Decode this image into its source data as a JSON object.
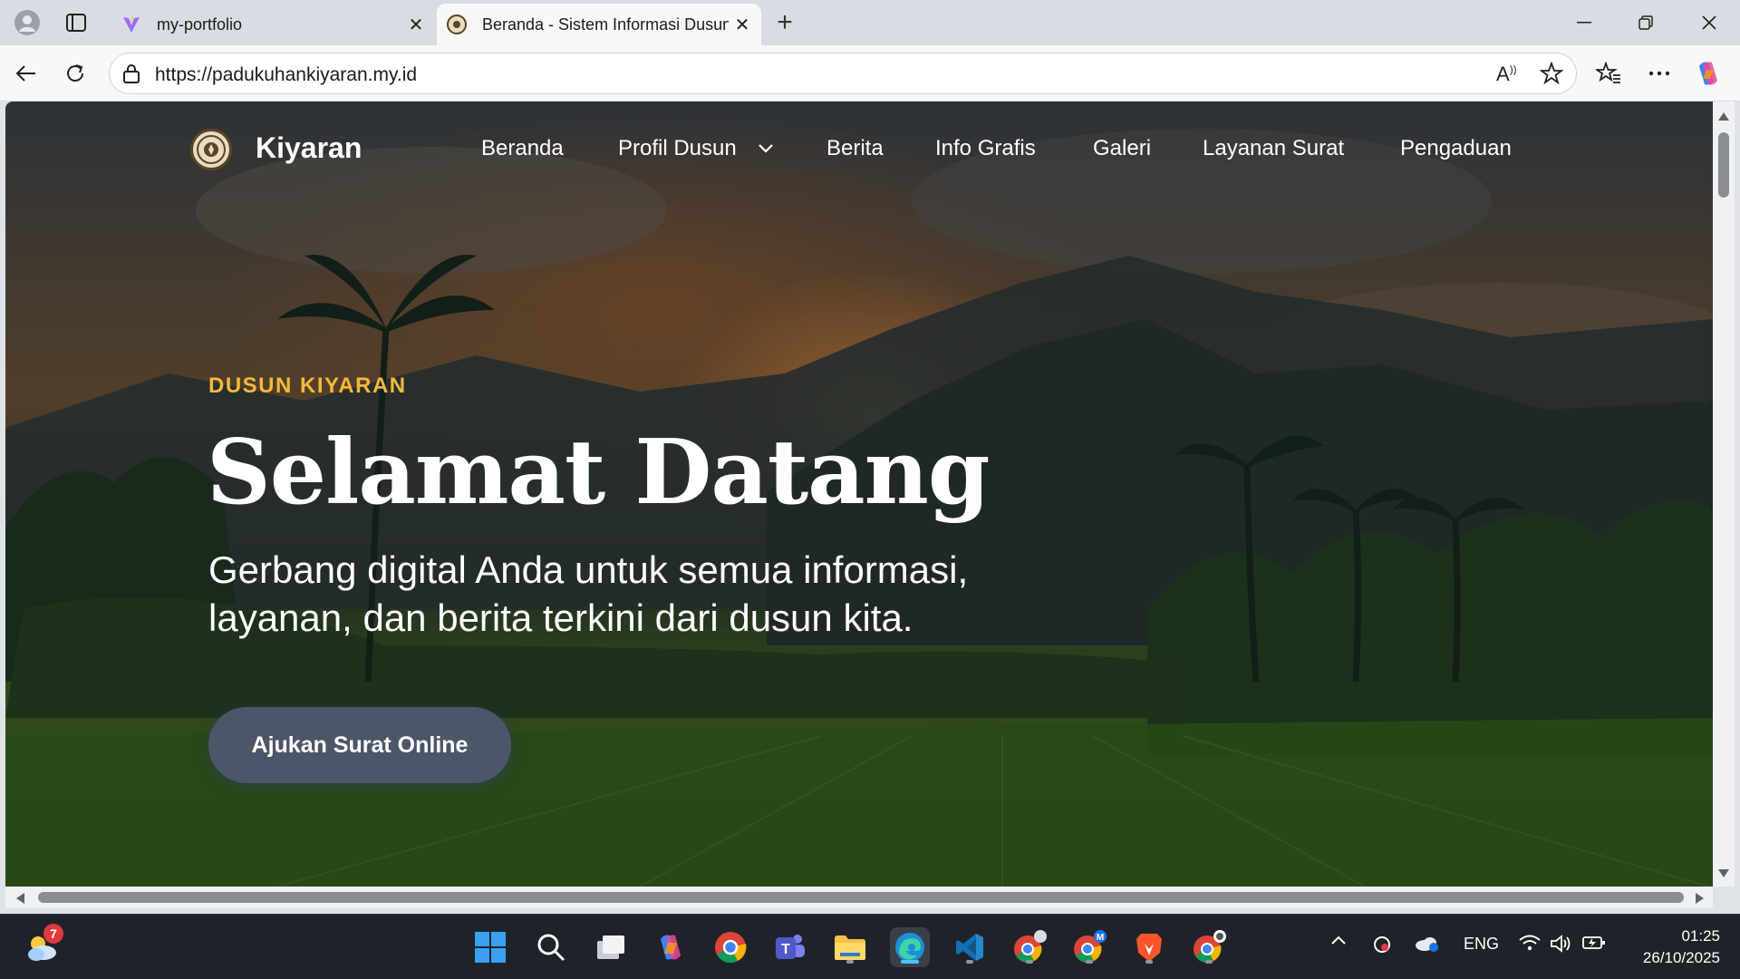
{
  "browser": {
    "tabs": [
      {
        "title": "my-portfolio",
        "favicon": "vite-icon",
        "active": false
      },
      {
        "title": "Beranda - Sistem Informasi Dusun",
        "favicon": "village-seal-icon",
        "active": true
      }
    ],
    "address_url": "https://padukuhankiyaran.my.id"
  },
  "site": {
    "brand": "Kiyaran",
    "nav": [
      "Beranda",
      "Profil Dusun",
      "Berita",
      "Info Grafis",
      "Galeri",
      "Layanan Surat",
      "Pengaduan"
    ]
  },
  "hero": {
    "kicker": "DUSUN KIYARAN",
    "headline": "Selamat Datang",
    "subtitle_line1": "Gerbang digital Anda untuk semua informasi,",
    "subtitle_line2": "layanan, dan berita terkini dari dusun kita.",
    "cta_label": "Ajukan Surat Online"
  },
  "colors": {
    "kicker": "#f4b93a",
    "cta_bg": "#4d5668",
    "taskbar_bg": "#1f2329"
  },
  "taskbar": {
    "weather_badge": "7",
    "language": "ENG",
    "time": "01:25",
    "date": "26/10/2025"
  }
}
